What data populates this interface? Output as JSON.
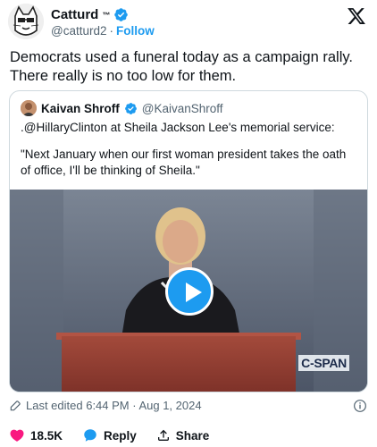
{
  "author": {
    "name": "Catturd",
    "tm": "™",
    "handle": "@catturd2",
    "separator": "·",
    "follow_label": "Follow"
  },
  "tweet": {
    "text": "Democrats used a funeral today as a campaign rally. There really is no too low for them."
  },
  "quoted": {
    "name": "Kaivan Shroff",
    "handle": "@KaivanShroff",
    "line1": ".@HillaryClinton at Sheila Jackson Lee's memorial service:",
    "line2": "\"Next January when our first woman president takes the oath of office, I'll be thinking of Sheila.\"",
    "video_watermark": "C-SPAN"
  },
  "meta": {
    "edited": "Last edited 6:44 PM · Aug 1, 2024"
  },
  "actions": {
    "likes": "18.5K",
    "reply_label": "Reply",
    "share_label": "Share"
  },
  "colors": {
    "accent": "#1d9bf0",
    "like": "#f91880",
    "secondary_text": "#536471"
  }
}
